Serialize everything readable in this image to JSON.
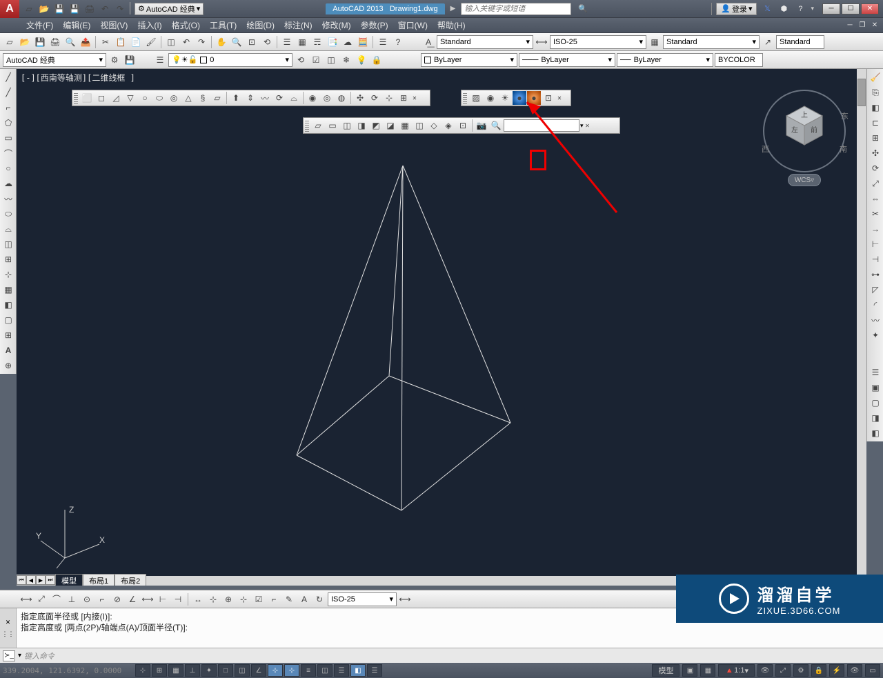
{
  "app": {
    "title_prefix": "AutoCAD 2013",
    "document": "Drawing1.dwg",
    "workspace": "AutoCAD 经典",
    "search_placeholder": "输入关键字或短语",
    "login_label": "登录"
  },
  "menu": {
    "items": [
      "文件(F)",
      "编辑(E)",
      "视图(V)",
      "插入(I)",
      "格式(O)",
      "工具(T)",
      "绘图(D)",
      "标注(N)",
      "修改(M)",
      "参数(P)",
      "窗口(W)",
      "帮助(H)"
    ]
  },
  "toolbar_top": {
    "workspace_selector": "AutoCAD 经典",
    "layer_state": "0",
    "text_style": "Standard",
    "dim_style": "ISO-25",
    "table_style": "Standard",
    "mleader_style": "Standard"
  },
  "toolbar_props": {
    "color": "ByLayer",
    "linetype": "ByLayer",
    "lineweight": "ByLayer",
    "plot_style": "BYCOLOR"
  },
  "viewport": {
    "label": "[-][西南等轴测][二维线框 ]"
  },
  "viewcube": {
    "wcs_label": "WCS",
    "faces": {
      "top": "上",
      "left": "左",
      "front": "前",
      "west": "西",
      "south": "南",
      "east": "东"
    }
  },
  "ucs": {
    "x": "X",
    "y": "Y",
    "z": "Z"
  },
  "layout_tabs": [
    "模型",
    "布局1",
    "布局2"
  ],
  "dim_toolbar": {
    "style": "ISO-25"
  },
  "command": {
    "history": [
      "指定底面半径或 [内接(I)]:",
      "指定高度或 [两点(2P)/轴端点(A)/顶面半径(T)]:"
    ],
    "prompt_placeholder": "键入命令"
  },
  "status": {
    "coords": "339.2004, 121.6392, 0.0000",
    "model_label": "模型",
    "scale": "1:1"
  },
  "watermark": {
    "title": "溜溜自学",
    "url": "ZIXUE.3D66.COM"
  }
}
